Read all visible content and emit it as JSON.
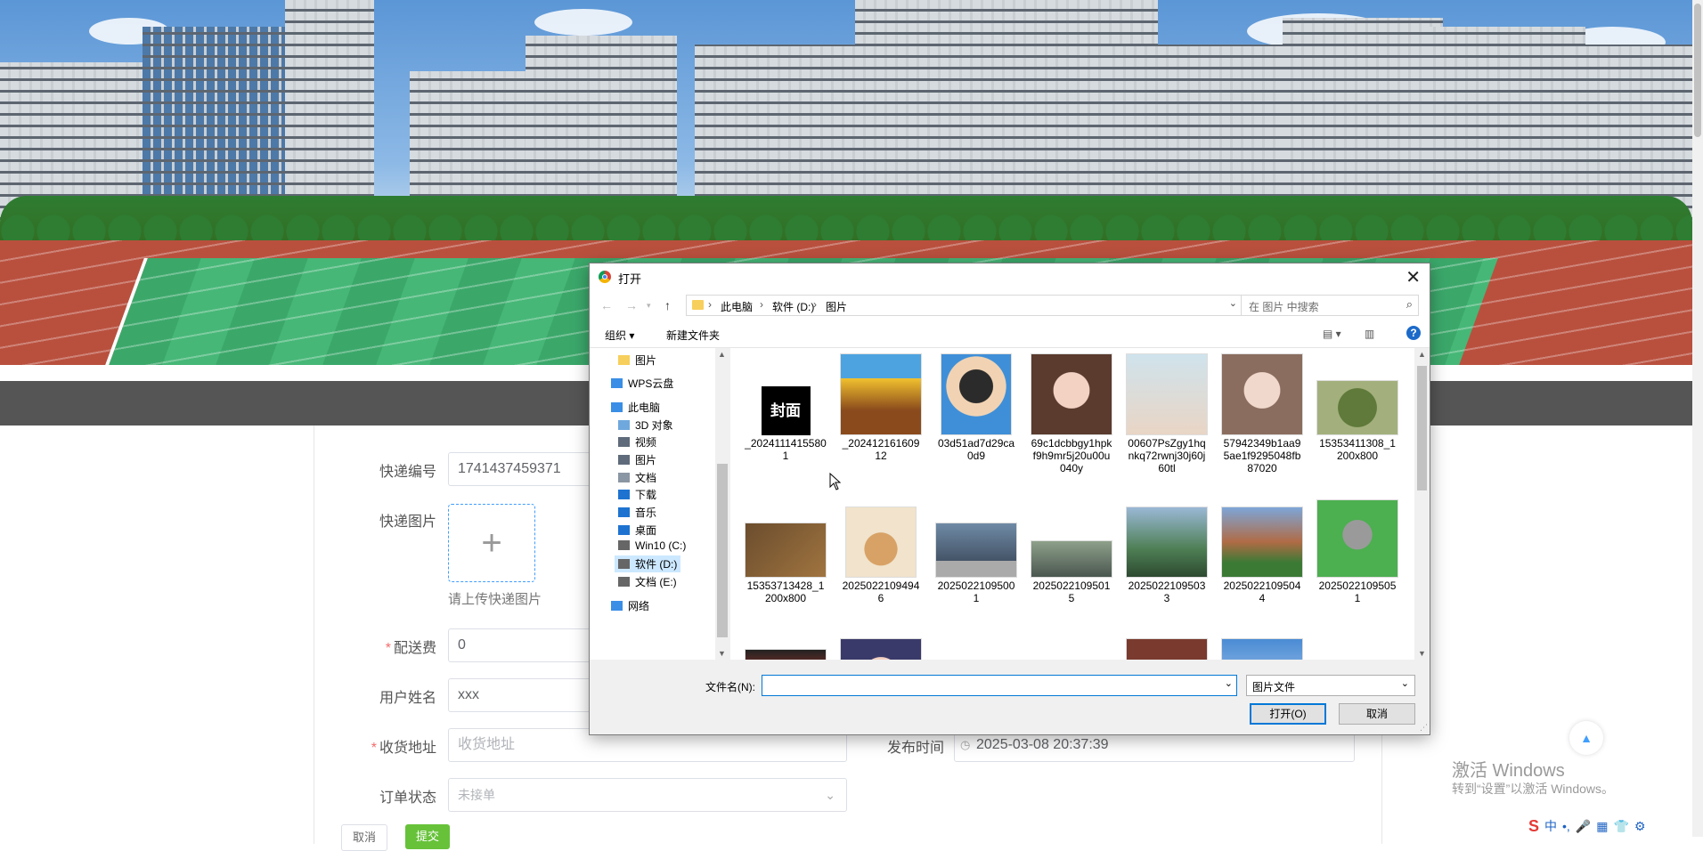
{
  "form": {
    "tracking_no_label": "快递编号",
    "tracking_no_value": "1741437459371",
    "image_label": "快递图片",
    "upload_plus": "+",
    "upload_hint": "请上传快递图片",
    "fee_label": "配送费",
    "fee_value": "0",
    "username_label": "用户姓名",
    "username_value": "xxx",
    "address_label": "收货地址",
    "address_placeholder": "收货地址",
    "publish_time_label": "发布时间",
    "publish_time_value": "2025-03-08 20:37:39",
    "status_label": "订单状态",
    "status_placeholder": "未接单",
    "cancel_button": "取消",
    "submit_button": "提交"
  },
  "watermark": {
    "line1": "激活 Windows",
    "line2": "转到“设置”以激活 Windows。"
  },
  "tray": [
    "中",
    "•,",
    "🎤",
    "▦",
    "👕",
    "⚙"
  ],
  "dialog": {
    "title": "打开",
    "close": "✕",
    "breadcrumb": [
      "此电脑",
      "软件 (D:)",
      "图片"
    ],
    "search_placeholder": "在 图片 中搜索",
    "organize": "组织 ▾",
    "new_folder": "新建文件夹",
    "tree": [
      {
        "label": "图片",
        "icon": "folder-icon"
      },
      {
        "label": "WPS云盘",
        "icon": "cloud-icon"
      },
      {
        "label": "此电脑",
        "icon": "computer-icon"
      },
      {
        "label": "3D 对象",
        "icon": "cube-icon"
      },
      {
        "label": "视频",
        "icon": "video-icon"
      },
      {
        "label": "图片",
        "icon": "pictures-icon"
      },
      {
        "label": "文档",
        "icon": "document-icon"
      },
      {
        "label": "下载",
        "icon": "download-icon"
      },
      {
        "label": "音乐",
        "icon": "music-icon"
      },
      {
        "label": "桌面",
        "icon": "desktop-icon"
      },
      {
        "label": "Win10 (C:)",
        "icon": "drive-icon"
      },
      {
        "label": "软件 (D:)",
        "icon": "drive-icon"
      },
      {
        "label": "文档 (E:)",
        "icon": "drive-icon"
      },
      {
        "label": "网络",
        "icon": "network-icon"
      }
    ],
    "files": [
      {
        "name": "_20241114155801",
        "thumb": "cover"
      },
      {
        "name": "_20241216160912",
        "thumb": "basketball"
      },
      {
        "name": "03d51ad7d29ca0d9",
        "thumb": "boy"
      },
      {
        "name": "69c1dcbbgy1hpkf9h9mr5j20u00u040y",
        "thumb": "girl1"
      },
      {
        "name": "00607PsZgy1hqnkq72rwnj30j60j60tl",
        "thumb": "girl2"
      },
      {
        "name": "57942349b1aa95ae1f9295048fb87020",
        "thumb": "girl3"
      },
      {
        "name": "15353411308_1200x800",
        "thumb": "tea"
      },
      {
        "name": "15353713428_1200x800",
        "thumb": "tea2"
      },
      {
        "name": "20250221094946",
        "thumb": "hamster"
      },
      {
        "name": "20250221095001",
        "thumb": "car"
      },
      {
        "name": "20250221095015",
        "thumb": "moto"
      },
      {
        "name": "20250221095033",
        "thumb": "mountain"
      },
      {
        "name": "20250221095044",
        "thumb": "house"
      },
      {
        "name": "20250221095051",
        "thumb": "kitten"
      },
      {
        "name": "",
        "thumb": "gpu"
      },
      {
        "name": "",
        "thumb": "girl4"
      },
      {
        "name": "",
        "thumb": "blue"
      },
      {
        "name": "",
        "thumb": "opera"
      },
      {
        "name": "",
        "thumb": "girl5"
      },
      {
        "name": "",
        "thumb": "sky"
      }
    ],
    "cover_text": "封面",
    "filename_label": "文件名(N):",
    "filename_value": "",
    "filetype": "图片文件",
    "open_button": "打开(O)",
    "cancel_button": "取消"
  },
  "colors": {
    "navbar": "#555555",
    "required": "#f56c6c",
    "upload_border": "#409eff",
    "submit": "#67c23a",
    "dialog_accent": "#0078d7"
  }
}
